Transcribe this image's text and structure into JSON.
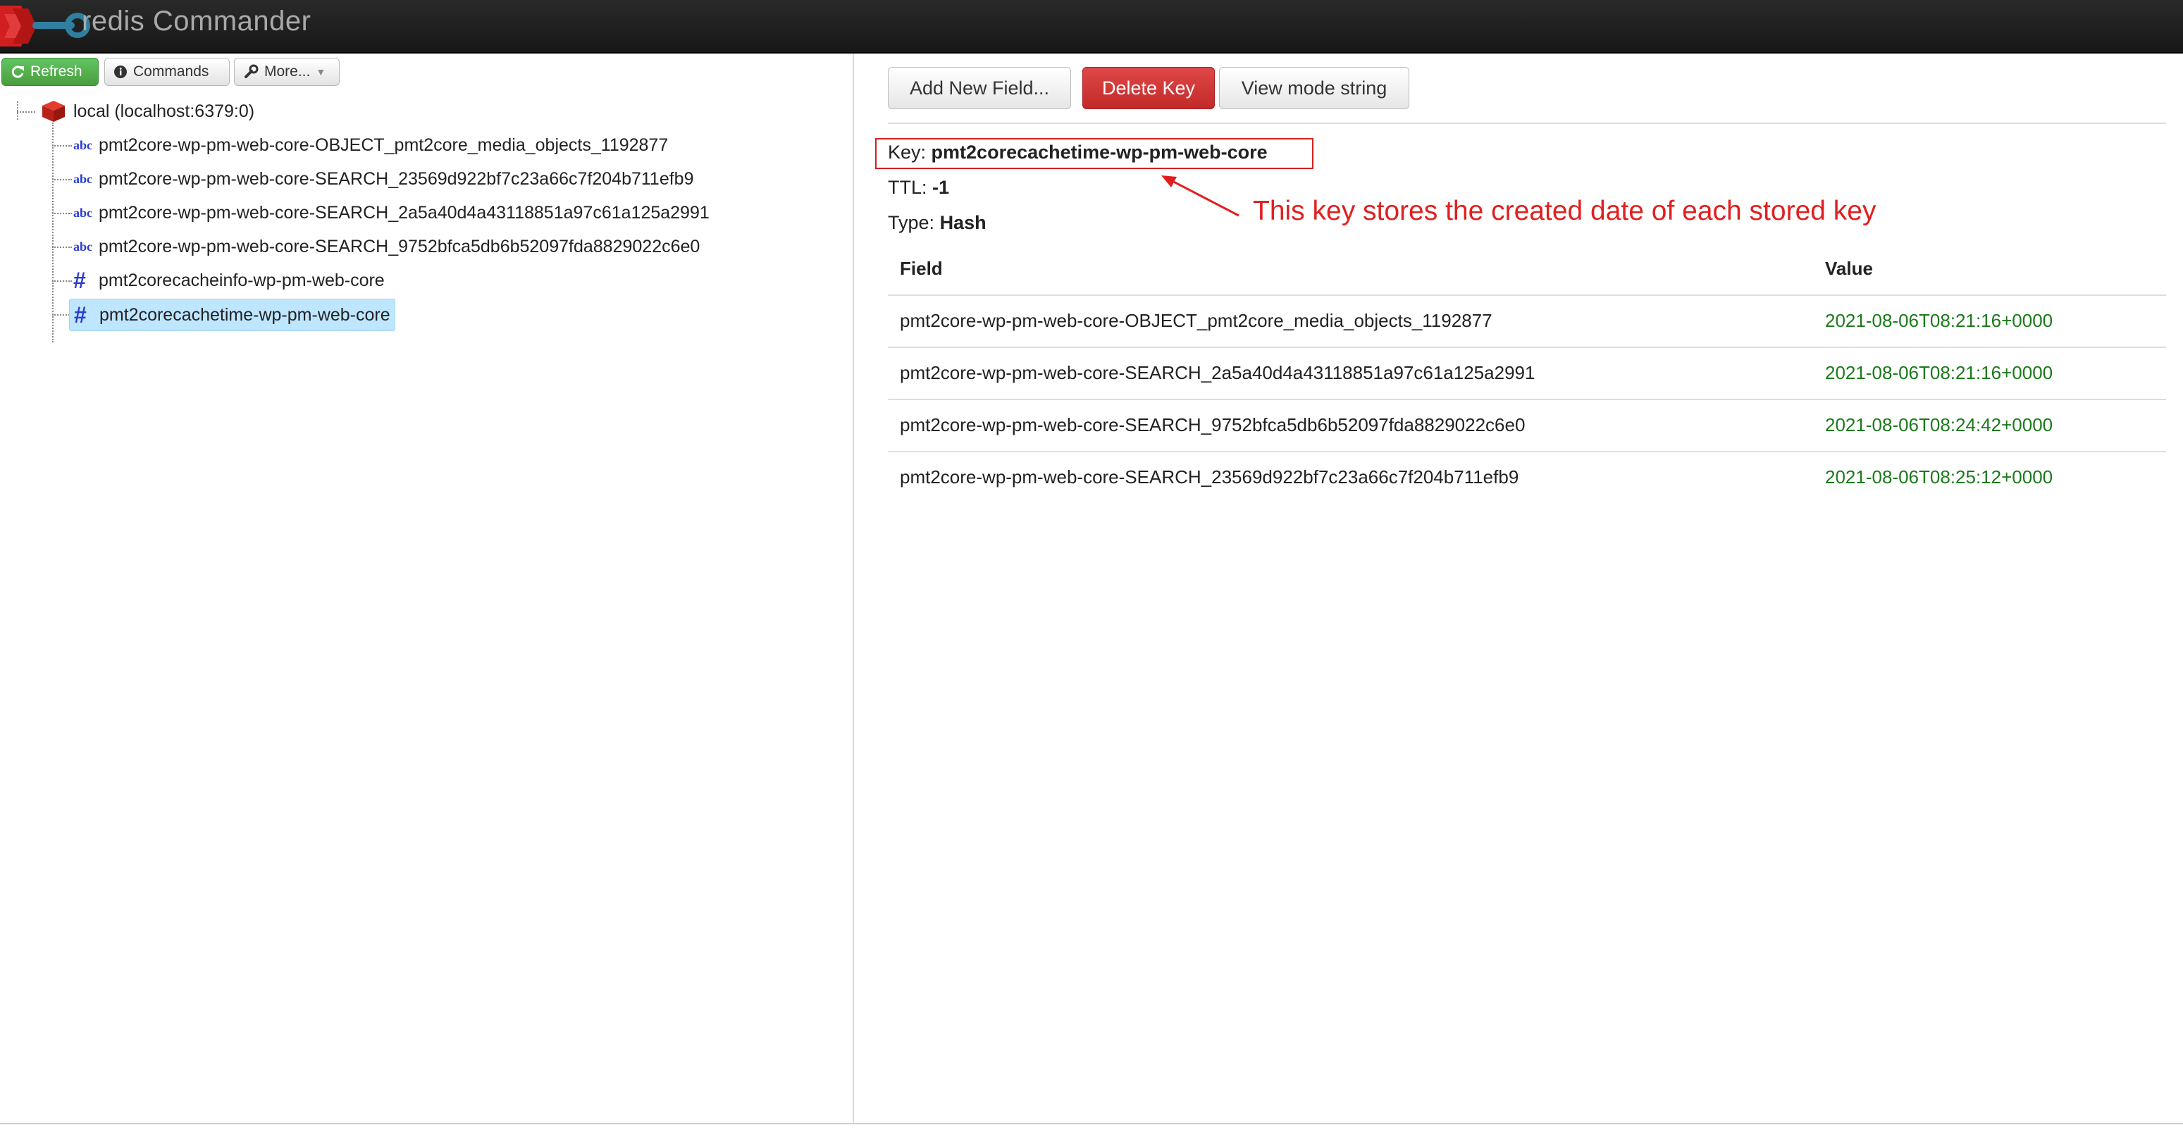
{
  "app": {
    "brand": "redis Commander"
  },
  "toolbar": {
    "refresh_label": "Refresh",
    "commands_label": "Commands",
    "more_label": "More..."
  },
  "tree": {
    "server_label": "local (localhost:6379:0)",
    "keys": [
      {
        "label": "pmt2core-wp-pm-web-core-OBJECT_pmt2core_media_objects_1192877",
        "type_icon": "string-abc-icon"
      },
      {
        "label": "pmt2core-wp-pm-web-core-SEARCH_23569d922bf7c23a66c7f204b711efb9",
        "type_icon": "string-abc-icon"
      },
      {
        "label": "pmt2core-wp-pm-web-core-SEARCH_2a5a40d4a43118851a97c61a125a2991",
        "type_icon": "string-abc-icon"
      },
      {
        "label": "pmt2core-wp-pm-web-core-SEARCH_9752bfca5db6b52097fda8829022c6e0",
        "type_icon": "string-abc-icon"
      },
      {
        "label": "pmt2corecacheinfo-wp-pm-web-core",
        "type_icon": "hash-icon"
      },
      {
        "label": "pmt2corecachetime-wp-pm-web-core",
        "type_icon": "hash-icon",
        "selected": true
      }
    ]
  },
  "actions": {
    "add_field": "Add New Field...",
    "delete_key": "Delete Key",
    "view_mode": "View mode string"
  },
  "details": {
    "key_label": "Key:",
    "key_value": "pmt2corecachetime-wp-pm-web-core",
    "ttl_label": "TTL:",
    "ttl_value": "-1",
    "type_label": "Type:",
    "type_value": "Hash"
  },
  "annotation": "This key stores the created date of each stored key",
  "table": {
    "headers": {
      "field": "Field",
      "value": "Value"
    },
    "rows": [
      {
        "field": "pmt2core-wp-pm-web-core-OBJECT_pmt2core_media_objects_1192877",
        "value": "2021-08-06T08:21:16+0000"
      },
      {
        "field": "pmt2core-wp-pm-web-core-SEARCH_2a5a40d4a43118851a97c61a125a2991",
        "value": "2021-08-06T08:21:16+0000"
      },
      {
        "field": "pmt2core-wp-pm-web-core-SEARCH_9752bfca5db6b52097fda8829022c6e0",
        "value": "2021-08-06T08:24:42+0000"
      },
      {
        "field": "pmt2core-wp-pm-web-core-SEARCH_23569d922bf7c23a66c7f204b711efb9",
        "value": "2021-08-06T08:25:12+0000"
      }
    ]
  },
  "colors": {
    "annotation": "#e02020",
    "value_text": "#1b7a1b",
    "delete_button": "#c22a2a",
    "refresh_button": "#4a9d3f",
    "selected_row": "#bfe6ff"
  }
}
